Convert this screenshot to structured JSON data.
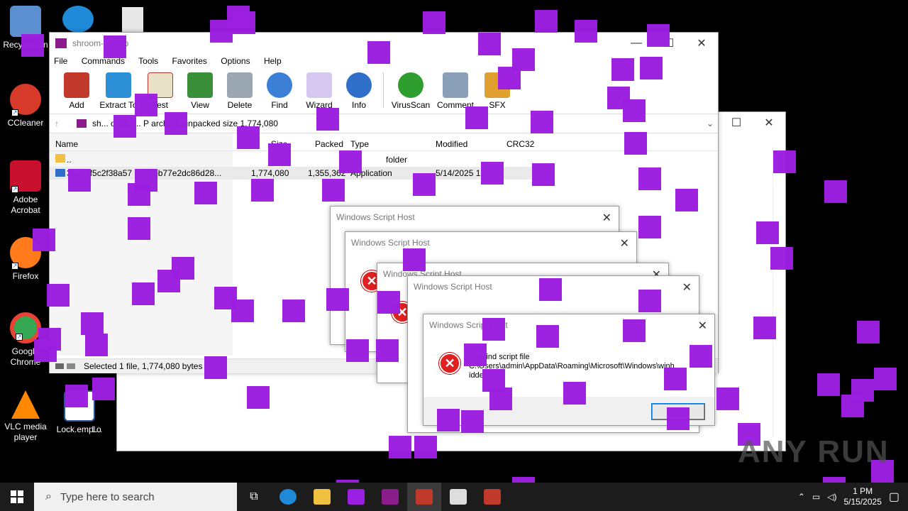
{
  "desktop": {
    "icons": [
      {
        "label": "Recycle Bin",
        "color": "#5b8fd0"
      },
      {
        "label": "CCleaner",
        "color": "#d83a2a"
      },
      {
        "label": "Adobe Acrobat",
        "color": "#c8102e"
      },
      {
        "label": "Firefox",
        "color": "#ff7b1c"
      },
      {
        "label": "Google Chrome",
        "color": "#34a853"
      },
      {
        "label": "VLC media player",
        "color": "#ff8800"
      },
      {
        "label": "Lock.empl...",
        "color": "#2b579a"
      },
      {
        "label": "Lo",
        "color": "#444444"
      }
    ],
    "watermark": "ANY RUN"
  },
  "winrar": {
    "title": "shroom-t... .zip",
    "menu": [
      "File",
      "Commands",
      "Tools",
      "Favorites",
      "Options",
      "Help"
    ],
    "toolbar": [
      "Add",
      "Extract To",
      "Test",
      "View",
      "Delete",
      "Find",
      "Wizard",
      "Info",
      "VirusScan",
      "Comment",
      "SFX"
    ],
    "path": "sh... oom.z... P archive, unpacked size 1,774,080",
    "columns": [
      "Name",
      "Size",
      "Packed",
      "Type",
      "Modified",
      "CRC32"
    ],
    "rows": [
      {
        "name": "..",
        "size": "",
        "packed": "",
        "type": "folder",
        "modified": ""
      },
      {
        "name": "3c... 7f5c2f38a57 ... 07bb77e2dc86d28...",
        "size": "1,774,080",
        "packed": "1,355,362",
        "type": "Application",
        "modified": "5/14/2025 12..."
      }
    ],
    "status": "Selected 1 file, 1,774,080 bytes"
  },
  "dialogs": {
    "title": "Windows Script Host",
    "message_line1": "...ot find script file",
    "message_line2": "C:\\Users\\admin\\AppData\\Roaming\\Microsoft\\Windows\\winh",
    "message_line3": "idde... .",
    "ok_label": ""
  },
  "taskbar": {
    "search_placeholder": "Type here to search",
    "time": "1 PM",
    "date": "5/15/2025"
  },
  "colors": {
    "accent_purple": "#9b1fe0",
    "selection": "#cce4f7",
    "error_red": "#e02020"
  }
}
